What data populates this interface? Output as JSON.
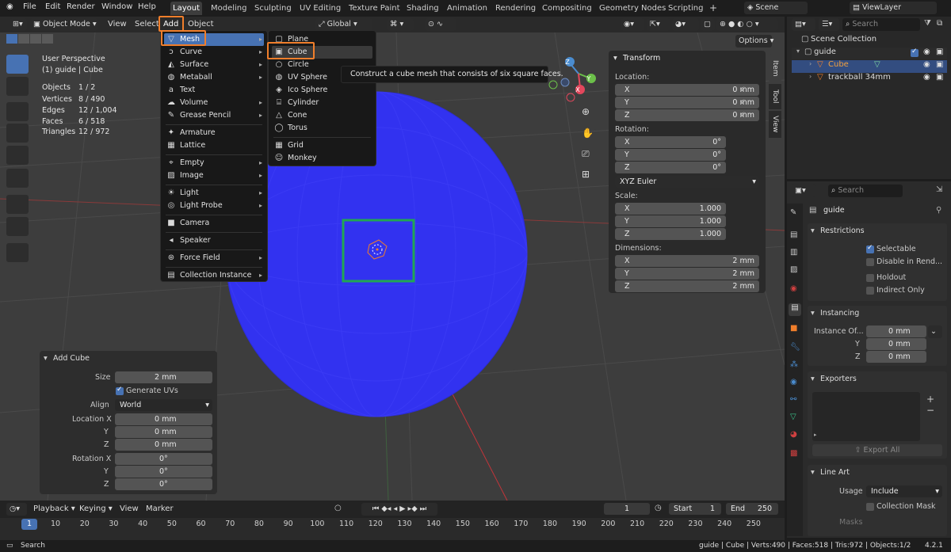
{
  "menubar": {
    "items": [
      "File",
      "Edit",
      "Render",
      "Window",
      "Help"
    ]
  },
  "workspaces": [
    "Layout",
    "Modeling",
    "Sculpting",
    "UV Editing",
    "Texture Paint",
    "Shading",
    "Animation",
    "Rendering",
    "Compositing",
    "Geometry Nodes",
    "Scripting"
  ],
  "scene": "Scene",
  "view_layer": "ViewLayer",
  "header": {
    "mode": "Object Mode",
    "view": "View",
    "select": "Select",
    "add": "Add",
    "object": "Object",
    "transform": "Global",
    "options": "Options"
  },
  "viewport_info": {
    "title": "User Perspective",
    "subtitle": "(1) guide | Cube",
    "stats": [
      {
        "label": "Objects",
        "value": "1 / 2"
      },
      {
        "label": "Vertices",
        "value": "8 / 490"
      },
      {
        "label": "Edges",
        "value": "12 / 1,004"
      },
      {
        "label": "Faces",
        "value": "6 / 518"
      },
      {
        "label": "Triangles",
        "value": "12 / 972"
      }
    ]
  },
  "add_menu": {
    "items": [
      "Mesh",
      "Curve",
      "Surface",
      "Metaball",
      "Text",
      "Volume",
      "Grease Pencil",
      "Armature",
      "Lattice",
      "Empty",
      "Image",
      "Light",
      "Light Probe",
      "Camera",
      "Speaker",
      "Force Field",
      "Collection Instance"
    ]
  },
  "mesh_menu": {
    "items": [
      "Plane",
      "Cube",
      "Circle",
      "UV Sphere",
      "Ico Sphere",
      "Cylinder",
      "Cone",
      "Torus",
      "Grid",
      "Monkey"
    ]
  },
  "tooltip": "Construct a cube mesh that consists of six square faces.",
  "transform_panel": {
    "title": "Transform",
    "location_label": "Location:",
    "location": [
      {
        "axis": "X",
        "value": "0 mm"
      },
      {
        "axis": "Y",
        "value": "0 mm"
      },
      {
        "axis": "Z",
        "value": "0 mm"
      }
    ],
    "rotation_label": "Rotation:",
    "rotation": [
      {
        "axis": "X",
        "value": "0°"
      },
      {
        "axis": "Y",
        "value": "0°"
      },
      {
        "axis": "Z",
        "value": "0°"
      }
    ],
    "rotation_mode": "XYZ Euler",
    "scale_label": "Scale:",
    "scale": [
      {
        "axis": "X",
        "value": "1.000"
      },
      {
        "axis": "Y",
        "value": "1.000"
      },
      {
        "axis": "Z",
        "value": "1.000"
      }
    ],
    "dimensions_label": "Dimensions:",
    "dimensions": [
      {
        "axis": "X",
        "value": "2 mm"
      },
      {
        "axis": "Y",
        "value": "2 mm"
      },
      {
        "axis": "Z",
        "value": "2 mm"
      }
    ]
  },
  "side_tabs": [
    "Item",
    "Tool",
    "View"
  ],
  "add_cube_panel": {
    "title": "Add Cube",
    "size_label": "Size",
    "size": "2 mm",
    "generate_uvs": "Generate UVs",
    "align_label": "Align",
    "align": "World",
    "location_label": "Location X",
    "loc_x": "0 mm",
    "loc_y": "0 mm",
    "loc_z": "0 mm",
    "rotation_label": "Rotation X",
    "rot_x": "0°",
    "rot_y": "0°",
    "rot_z": "0°",
    "y": "Y",
    "z": "Z"
  },
  "outliner": {
    "search": "Search",
    "items": [
      {
        "label": "Scene Collection"
      },
      {
        "label": "guide"
      },
      {
        "label": "Cube"
      },
      {
        "label": "trackball 34mm"
      }
    ]
  },
  "properties": {
    "search": "Search",
    "object_name": "guide",
    "restrictions": "Restrictions",
    "selectable": "Selectable",
    "disable_render": "Disable in Rend...",
    "holdout": "Holdout",
    "indirect_only": "Indirect Only",
    "instancing": "Instancing",
    "instance_offset": "Instance Of...",
    "inst_x": "0 mm",
    "inst_y": "0 mm",
    "inst_z": "0 mm",
    "y": "Y",
    "z": "Z",
    "exporters": "Exporters",
    "export_all": "Export All",
    "line_art": "Line Art",
    "usage_label": "Usage",
    "usage": "Include",
    "collection_mask": "Collection Mask",
    "masks": "Masks"
  },
  "timeline": {
    "playback": "Playback",
    "keying": "Keying",
    "view": "View",
    "marker": "Marker",
    "current_frame": "1",
    "start_label": "Start",
    "start": "1",
    "end_label": "End",
    "end": "250",
    "ticks": [
      "1",
      "10",
      "20",
      "30",
      "40",
      "50",
      "60",
      "70",
      "80",
      "90",
      "100",
      "110",
      "120",
      "130",
      "140",
      "150",
      "160",
      "170",
      "180",
      "190",
      "200",
      "210",
      "220",
      "230",
      "240",
      "250"
    ]
  },
  "statusbar": {
    "search": "Search",
    "info": "guide | Cube | Verts:490 | Faces:518 | Tris:972 | Objects:1/2",
    "version": "4.2.1"
  },
  "colors": {
    "accent": "#4772b3",
    "highlight": "#f07e2b",
    "sphere": "#3232f0",
    "green_box": "#21a653"
  }
}
